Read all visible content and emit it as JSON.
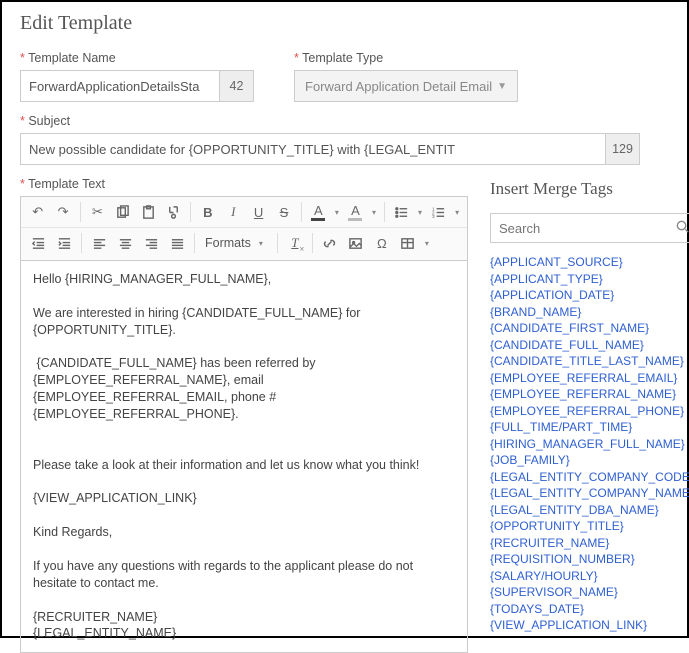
{
  "page_title": "Edit Template",
  "fields": {
    "template_name": {
      "label": "Template Name",
      "value": "ForwardApplicationDetailsSta",
      "count": "42"
    },
    "template_type": {
      "label": "Template Type",
      "value": "Forward Application Detail Email"
    },
    "subject": {
      "label": "Subject",
      "value": "New possible candidate for {OPPORTUNITY_TITLE} with {LEGAL_ENTIT",
      "count": "129"
    },
    "template_text_label": "Template Text"
  },
  "toolbar": {
    "formats": "Formats"
  },
  "editor_body": "Hello {HIRING_MANAGER_FULL_NAME},\n\nWe are interested in hiring {CANDIDATE_FULL_NAME} for {OPPORTUNITY_TITLE}.\n\n {CANDIDATE_FULL_NAME} has been referred by {EMPLOYEE_REFERRAL_NAME}, email {EMPLOYEE_REFERRAL_EMAIL, phone # {EMPLOYEE_REFERRAL_PHONE}.\n\n\nPlease take a look at their information and let us know what you think!\n\n{VIEW_APPLICATION_LINK}\n\nKind Regards,\n\nIf you have any questions with regards to the applicant please do not hesitate to contact me.\n\n{RECRUITER_NAME}\n{LEGAL_ENTITY_NAME}",
  "merge": {
    "title": "Insert Merge Tags",
    "search_placeholder": "Search",
    "tags": [
      "{APPLICANT_SOURCE}",
      "{APPLICANT_TYPE}",
      "{APPLICATION_DATE}",
      "{BRAND_NAME}",
      "{CANDIDATE_FIRST_NAME}",
      "{CANDIDATE_FULL_NAME}",
      "{CANDIDATE_TITLE_LAST_NAME}",
      "{EMPLOYEE_REFERRAL_EMAIL}",
      "{EMPLOYEE_REFERRAL_NAME}",
      "{EMPLOYEE_REFERRAL_PHONE}",
      "{FULL_TIME/PART_TIME}",
      "{HIRING_MANAGER_FULL_NAME}",
      "{JOB_FAMILY}",
      "{LEGAL_ENTITY_COMPANY_CODE}",
      "{LEGAL_ENTITY_COMPANY_NAME}",
      "{LEGAL_ENTITY_DBA_NAME}",
      "{OPPORTUNITY_TITLE}",
      "{RECRUITER_NAME}",
      "{REQUISITION_NUMBER}",
      "{SALARY/HOURLY}",
      "{SUPERVISOR_NAME}",
      "{TODAYS_DATE}",
      "{VIEW_APPLICATION_LINK}"
    ]
  }
}
